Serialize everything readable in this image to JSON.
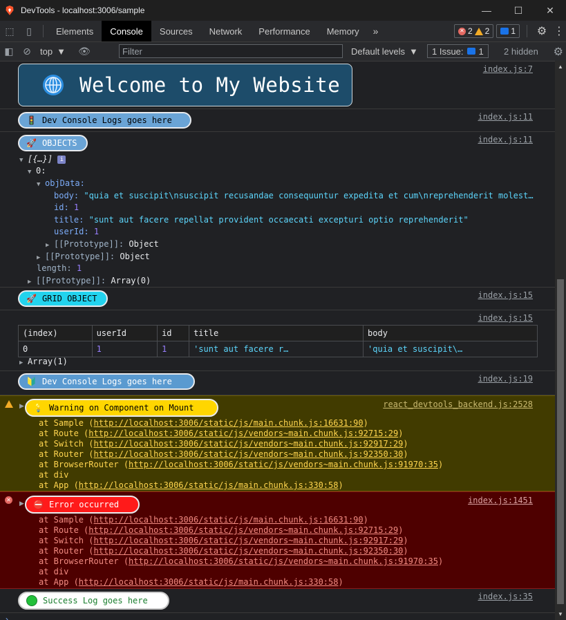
{
  "window": {
    "title": "DevTools - localhost:3006/sample"
  },
  "tabs": [
    "Elements",
    "Console",
    "Sources",
    "Network",
    "Performance",
    "Memory"
  ],
  "tabs_more": "»",
  "counters": {
    "errors": "2",
    "warnings": "2",
    "messages": "1"
  },
  "filterbar": {
    "context": "top",
    "filter_placeholder": "Filter",
    "levels": "Default levels",
    "issues": "1 Issue:",
    "issues_count": "1",
    "hidden": "2 hidden"
  },
  "logs": {
    "banner": {
      "text": "Welcome to My Website",
      "source": "index.js:7"
    },
    "dev1": {
      "text": "Dev Console Logs goes here",
      "source": "index.js:11",
      "emoji": "🚦"
    },
    "objects": {
      "text": "OBJECTS",
      "source": "index.js:11",
      "emoji": "🚀",
      "root": "[{…}]",
      "index": "0:",
      "objData": "objData:",
      "body_key": "body:",
      "body_val": "\"quia et suscipit\\nsuscipit recusandae consequuntur expedita et cum\\nreprehenderit molest…",
      "id_key": "id:",
      "id_val": "1",
      "title_key": "title:",
      "title_val": "\"sunt aut facere repellat provident occaecati excepturi optio reprehenderit\"",
      "userId_key": "userId:",
      "userId_val": "1",
      "proto_inner": "[[Prototype]]:",
      "proto_inner_val": "Object",
      "proto_mid": "[[Prototype]]:",
      "proto_mid_val": "Object",
      "length_key": "length:",
      "length_val": "1",
      "proto_outer": "[[Prototype]]:",
      "proto_outer_val": "Array(0)"
    },
    "grid_label": {
      "text": "GRID OBJECT",
      "source": "index.js:15",
      "emoji": "🚀"
    },
    "table": {
      "source": "index.js:15",
      "headers": [
        "(index)",
        "userId",
        "id",
        "title",
        "body"
      ],
      "row": [
        "0",
        "1",
        "1",
        "'sunt aut facere r…",
        "'quia et suscipit\\…"
      ],
      "footer": "Array(1)"
    },
    "dev2": {
      "text": "Dev Console Logs goes here",
      "source": "index.js:19",
      "emoji": "🔰"
    },
    "warning": {
      "text": "Warning on Component on Mount",
      "source": "react_devtools_backend.js:2528",
      "emoji": "💡",
      "stack": [
        [
          "at Sample (",
          "http://localhost:3006/static/js/main.chunk.js:16631:90",
          ")"
        ],
        [
          "at Route (",
          "http://localhost:3006/static/js/vendors~main.chunk.js:92715:29",
          ")"
        ],
        [
          "at Switch (",
          "http://localhost:3006/static/js/vendors~main.chunk.js:92917:29",
          ")"
        ],
        [
          "at Router (",
          "http://localhost:3006/static/js/vendors~main.chunk.js:92350:30",
          ")"
        ],
        [
          "at BrowserRouter (",
          "http://localhost:3006/static/js/vendors~main.chunk.js:91970:35",
          ")"
        ],
        [
          "at div",
          "",
          ""
        ],
        [
          "at App (",
          "http://localhost:3006/static/js/main.chunk.js:330:58",
          ")"
        ]
      ]
    },
    "error": {
      "text": "Error occurred",
      "source": "index.js:1451",
      "emoji": "⛔",
      "stack": [
        [
          "at Sample (",
          "http://localhost:3006/static/js/main.chunk.js:16631:90",
          ")"
        ],
        [
          "at Route (",
          "http://localhost:3006/static/js/vendors~main.chunk.js:92715:29",
          ")"
        ],
        [
          "at Switch (",
          "http://localhost:3006/static/js/vendors~main.chunk.js:92917:29",
          ")"
        ],
        [
          "at Router (",
          "http://localhost:3006/static/js/vendors~main.chunk.js:92350:30",
          ")"
        ],
        [
          "at BrowserRouter (",
          "http://localhost:3006/static/js/vendors~main.chunk.js:91970:35",
          ")"
        ],
        [
          "at div",
          "",
          ""
        ],
        [
          "at App (",
          "http://localhost:3006/static/js/main.chunk.js:330:58",
          ")"
        ]
      ]
    },
    "success": {
      "text": "Success Log goes here",
      "source": "index.js:35"
    }
  },
  "prompt": "›",
  "colors": {
    "warn_bg": "#413b00",
    "err_bg": "#4e0000",
    "pill_blue": "#5aa0d8",
    "pill_cyan": "#22d3ee",
    "pill_yellow": "#ffd600",
    "pill_red": "#ff1a1a"
  }
}
